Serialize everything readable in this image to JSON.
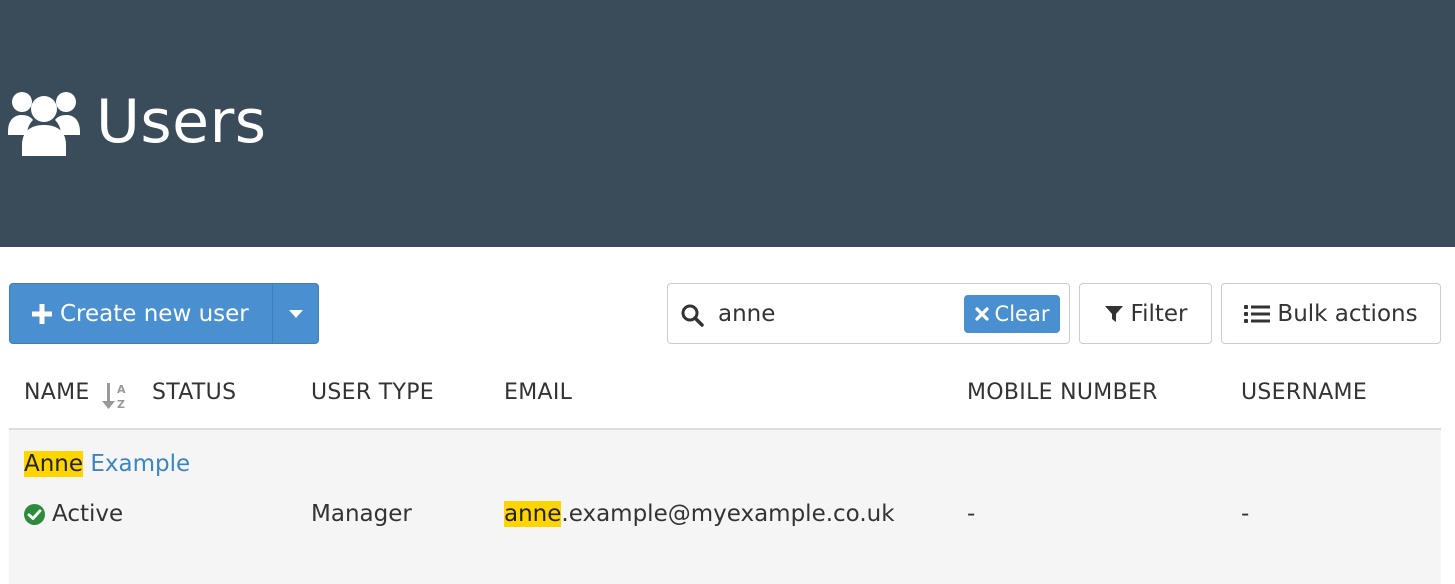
{
  "header": {
    "title": "Users",
    "icon": "users-icon"
  },
  "toolbar": {
    "create_label": "Create new user",
    "search_value": "anne",
    "clear_label": "Clear",
    "filter_label": "Filter",
    "bulk_label": "Bulk actions"
  },
  "table": {
    "columns": [
      "NAME",
      "STATUS",
      "USER TYPE",
      "EMAIL",
      "MOBILE NUMBER",
      "USERNAME"
    ],
    "rows": [
      {
        "name_match": "Anne",
        "name_rest": " Example",
        "status": "Active",
        "user_type": "Manager",
        "email_match": "anne",
        "email_rest": ".example@myexample.co.uk",
        "mobile": "-",
        "username": "-"
      }
    ]
  },
  "colors": {
    "header_bg": "#3a4b5a",
    "primary": "#4a90d1",
    "highlight": "#ffd500",
    "status_active": "#2e8b3e",
    "link": "#3a85c6"
  }
}
